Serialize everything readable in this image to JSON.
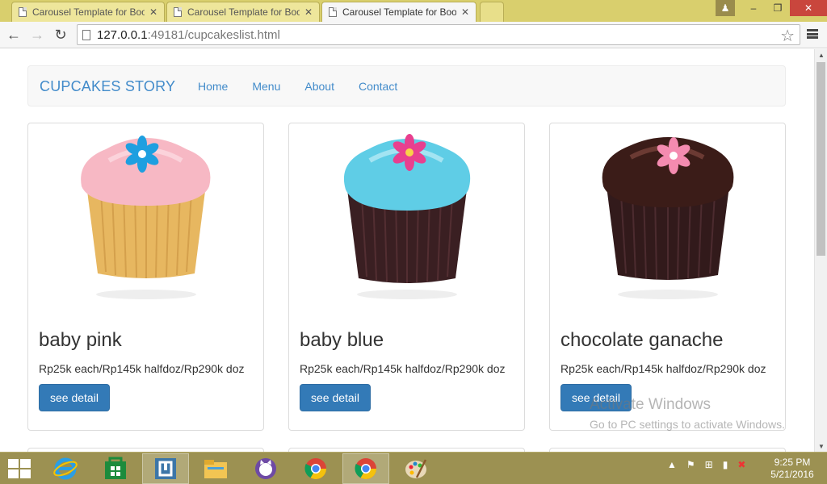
{
  "browser": {
    "tabs": [
      {
        "title": "Carousel Template for Boo",
        "active": false
      },
      {
        "title": "Carousel Template for Boo",
        "active": false
      },
      {
        "title": "Carousel Template for Boo",
        "active": true
      }
    ],
    "url_host": "127.0.0.1",
    "url_rest": ":49181/cupcakeslist.html",
    "window_buttons": {
      "minimize": "–",
      "restore": "❐",
      "close": "✕"
    }
  },
  "page": {
    "brand": "CUPCAKES STORY",
    "nav": [
      {
        "label": "Home"
      },
      {
        "label": "Menu"
      },
      {
        "label": "About"
      },
      {
        "label": "Contact"
      }
    ],
    "products": [
      {
        "name": "baby pink",
        "price": "Rp25k each/Rp145k halfdoz/Rp290k doz",
        "button": "see detail",
        "frosting": "#f7b8c4",
        "wrapper": "#e8b862",
        "flower": "#1e9fe0"
      },
      {
        "name": "baby blue",
        "price": "Rp25k each/Rp145k halfdoz/Rp290k doz",
        "button": "see detail",
        "frosting": "#5fcde6",
        "wrapper": "#3a1f22",
        "flower": "#e83f8f"
      },
      {
        "name": "chocolate ganache",
        "price": "Rp25k each/Rp145k halfdoz/Rp290k doz",
        "button": "see detail",
        "frosting": "#3b1c18",
        "wrapper": "#321a1b",
        "flower": "#f48bb0"
      }
    ]
  },
  "watermark": {
    "title": "Activate Windows",
    "subtitle": "Go to PC settings to activate Windows."
  },
  "taskbar": {
    "apps": [
      "internet-explorer",
      "windows-store",
      "visual-studio",
      "file-explorer",
      "github-app",
      "chrome",
      "chrome",
      "paint"
    ],
    "time": "9:25 PM",
    "date": "5/21/2016"
  },
  "colors": {
    "tab_strip": "#d9cf6d",
    "taskbar": "#9c9152",
    "link": "#428bca",
    "button": "#337ab7"
  }
}
